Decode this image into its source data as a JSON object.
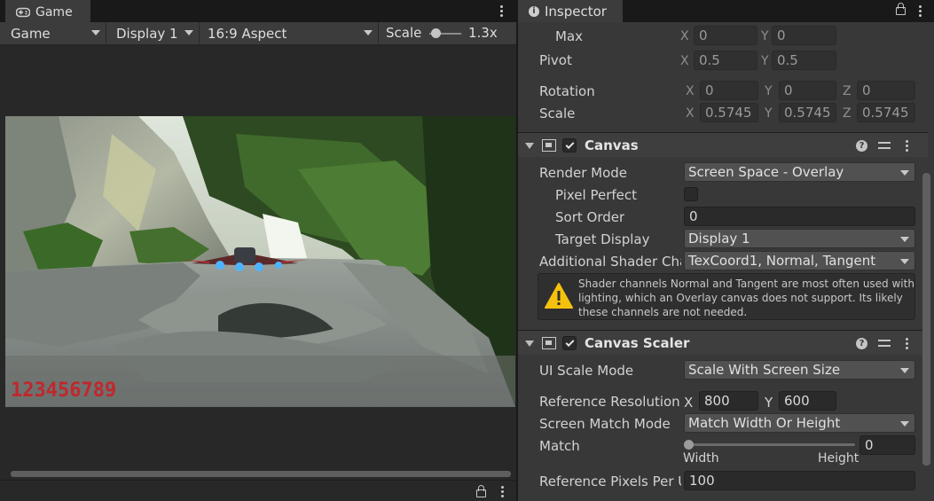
{
  "game": {
    "tab_title": "Game",
    "toolbar": {
      "mode": "Game",
      "display": "Display 1",
      "aspect": "16:9 Aspect",
      "scale_label": "Scale",
      "scale_value": "1.3x"
    },
    "score_text": "123456789"
  },
  "inspector": {
    "tab_title": "Inspector",
    "rect": {
      "max": {
        "label": "Max",
        "x": "0",
        "y": "0"
      },
      "pivot": {
        "label": "Pivot",
        "x": "0.5",
        "y": "0.5"
      },
      "rotation": {
        "label": "Rotation",
        "x": "0",
        "y": "0",
        "z": "0"
      },
      "scale": {
        "label": "Scale",
        "x": "0.5745",
        "y": "0.5745",
        "z": "0.5745"
      },
      "axis_x": "X",
      "axis_y": "Y",
      "axis_z": "Z"
    },
    "canvas": {
      "title": "Canvas",
      "render_mode_label": "Render Mode",
      "render_mode_value": "Screen Space - Overlay",
      "pixel_perfect_label": "Pixel Perfect",
      "sort_order_label": "Sort Order",
      "sort_order_value": "0",
      "target_display_label": "Target Display",
      "target_display_value": "Display 1",
      "shader_channels_label": "Additional Shader Cha",
      "shader_channels_value": "TexCoord1, Normal, Tangent",
      "warning": "Shader channels Normal and Tangent are most often used with lighting, which an Overlay canvas does not support. Its likely these channels are not needed."
    },
    "canvas_scaler": {
      "title": "Canvas Scaler",
      "ui_scale_mode_label": "UI Scale Mode",
      "ui_scale_mode_value": "Scale With Screen Size",
      "ref_resolution_label": "Reference Resolution",
      "ref_x": "800",
      "ref_y": "600",
      "match_mode_label": "Screen Match Mode",
      "match_mode_value": "Match Width Or Height",
      "match_label": "Match",
      "match_value": "0",
      "width_label": "Width",
      "height_label": "Height",
      "ref_ppu_label": "Reference Pixels Per U",
      "ref_ppu_value": "100"
    }
  },
  "colors": {
    "panel": "#383838",
    "score": "#c0272d",
    "warning": "#f4c20d"
  }
}
